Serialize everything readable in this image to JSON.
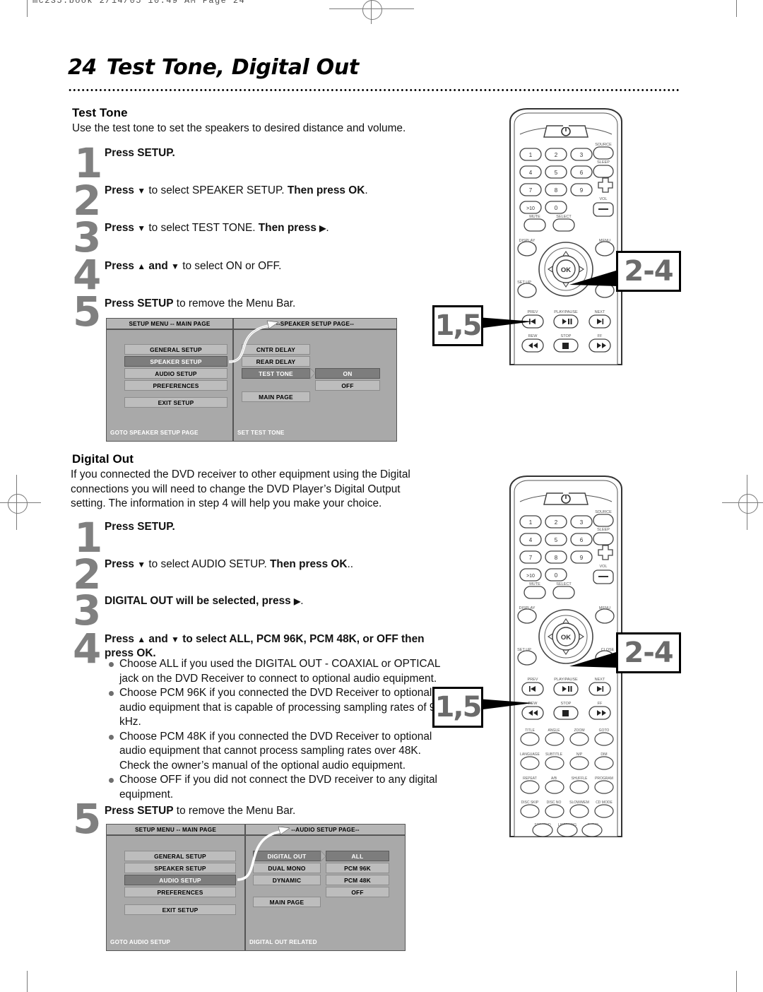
{
  "print_header": "mc235.book  2/14/05  10:49 AM  Page 24",
  "page": {
    "number": "24",
    "title": "Test Tone, Digital Out"
  },
  "sections": [
    {
      "id": "test-tone",
      "heading": "Test Tone",
      "intro": "Use the test tone to set the speakers to desired distance and volume.",
      "steps": [
        {
          "num": "1",
          "html": "<b>Press SETUP.</b>"
        },
        {
          "num": "2",
          "html": "<b>Press <span class='arw'>▼</span></b> to select SPEAKER SETUP.  <b>Then press OK</b>."
        },
        {
          "num": "3",
          "html": "<b>Press <span class='arw'>▼</span></b> to select TEST TONE. <b>Then press <span class='arw'>▶</span></b>."
        },
        {
          "num": "4",
          "html": "<b>Press <span class='arw'>▲</span> and <span class='arw'>▼</span></b> to select ON or OFF."
        },
        {
          "num": "5",
          "html": "<b>Press SETUP</b> to remove the Menu Bar."
        }
      ]
    },
    {
      "id": "digital-out",
      "heading": "Digital Out",
      "intro": "If you connected the DVD receiver to other equipment using the Digital connections you will need to change the DVD Player’s Digital Output setting. The information in step 4 will help you make your choice.",
      "steps": [
        {
          "num": "1",
          "html": "<b>Press SETUP.</b>"
        },
        {
          "num": "2",
          "html": "<b>Press <span class='arw'>▼</span></b> to select AUDIO SETUP.  <b>Then press OK</b>.."
        },
        {
          "num": "3",
          "html": "<b>DIGITAL OUT will be selected, press <span class='arw'>▶</span></b>."
        },
        {
          "num": "4",
          "html": "<b>Press <span class='arw'>▲</span> and <span class='arw'>▼</span> to select ALL, PCM 96K, PCM 48K, or OFF then press OK.</b>"
        },
        {
          "num": "5",
          "html": "<b>Press SETUP</b> to remove the Menu Bar."
        }
      ],
      "bullets": [
        "Choose ALL if you used the DIGITAL OUT - COAXIAL or OPTICAL jack on the DVD Receiver to connect to optional audio equipment.",
        "Choose PCM 96K if you connected the DVD Receiver to optional audio equipment that is capable of processing sampling rates of 96 kHz.",
        "Choose PCM 48K if you connected the DVD Receiver to optional audio equipment that cannot process sampling rates over 48K. Check the owner’s manual of the optional audio equipment.",
        "Choose OFF if you did not connect the DVD receiver to any digital equipment."
      ]
    }
  ],
  "osd_speaker": {
    "left_title": "SETUP MENU -- MAIN PAGE",
    "right_title": "--SPEAKER SETUP PAGE--",
    "left_items": [
      {
        "label": "GENERAL SETUP",
        "selected": false
      },
      {
        "label": "SPEAKER SETUP",
        "selected": true
      },
      {
        "label": "AUDIO SETUP",
        "selected": false
      },
      {
        "label": "PREFERENCES",
        "selected": false
      },
      {
        "label": "EXIT SETUP",
        "selected": false
      }
    ],
    "mid_items": [
      {
        "label": "CNTR DELAY",
        "selected": false
      },
      {
        "label": "REAR DELAY",
        "selected": false
      },
      {
        "label": "TEST TONE",
        "selected": true
      },
      {
        "label": "MAIN PAGE",
        "selected": false
      }
    ],
    "right_items": [
      {
        "label": "ON",
        "selected": true
      },
      {
        "label": "OFF",
        "selected": false
      }
    ],
    "left_footer": "GOTO SPEAKER SETUP PAGE",
    "right_footer": "SET TEST TONE"
  },
  "osd_audio": {
    "left_title": "SETUP MENU -- MAIN PAGE",
    "right_title": "--AUDIO SETUP PAGE--",
    "left_items": [
      {
        "label": "GENERAL SETUP",
        "selected": false
      },
      {
        "label": "SPEAKER SETUP",
        "selected": false
      },
      {
        "label": "AUDIO SETUP",
        "selected": true
      },
      {
        "label": "PREFERENCES",
        "selected": false
      },
      {
        "label": "EXIT SETUP",
        "selected": false
      }
    ],
    "mid_items": [
      {
        "label": "DIGITAL OUT",
        "selected": true
      },
      {
        "label": "DUAL MONO",
        "selected": false
      },
      {
        "label": "DYNAMIC",
        "selected": false
      },
      {
        "label": "MAIN PAGE",
        "selected": false
      }
    ],
    "right_items": [
      {
        "label": "ALL",
        "selected": true
      },
      {
        "label": "PCM 96K",
        "selected": false
      },
      {
        "label": "PCM 48K",
        "selected": false
      },
      {
        "label": "OFF",
        "selected": false
      }
    ],
    "left_footer": "GOTO AUDIO SETUP",
    "right_footer": "DIGITAL OUT RELATED"
  },
  "callouts": {
    "nav_steps": "2-4",
    "setup_steps": "1,5"
  },
  "remote": {
    "power_icon": "power-icon",
    "numeric_keys": [
      "1",
      "2",
      "3",
      "4",
      "5",
      "6",
      "7",
      "8",
      "9",
      ">10",
      "0"
    ],
    "side_keys": [
      "SOURCE",
      "SLEEP"
    ],
    "vol_label": "VOL",
    "vol_plus": "+",
    "vol_minus": "–",
    "mute_label": "MUTE",
    "select_label": "SELECT",
    "display_label": "DISPLAY",
    "menu_label": "MENU",
    "setup_label": "SET UP",
    "close_label": "CLOSE",
    "ok_label": "OK",
    "transport_row1": [
      "PREV",
      "PLAY/PAUSE",
      "NEXT"
    ],
    "transport_row2": [
      "REW",
      "STOP",
      "FF"
    ],
    "extra_rows": [
      [
        "TITLE",
        "ANGLE",
        "ZOOM",
        "GOTO"
      ],
      [
        "LANGUAGE",
        "SUBTITLE",
        "N/P",
        "DIM"
      ],
      [
        "REPEAT",
        "A/B",
        "SHUFFLE",
        "PROGRAM"
      ],
      [
        "DISC SKIP",
        "DISC NO",
        "SLOW/MEM",
        "CD MODE"
      ],
      [
        "ST/MONO",
        "LISTENING",
        "AUDIO"
      ]
    ]
  },
  "colors": {
    "step_number": "#808080",
    "osd_panel": "#a9a9a9",
    "osd_button": "#bdbdbd",
    "osd_selected": "#7d7d7d",
    "callout_text": "#6b6b6b"
  }
}
